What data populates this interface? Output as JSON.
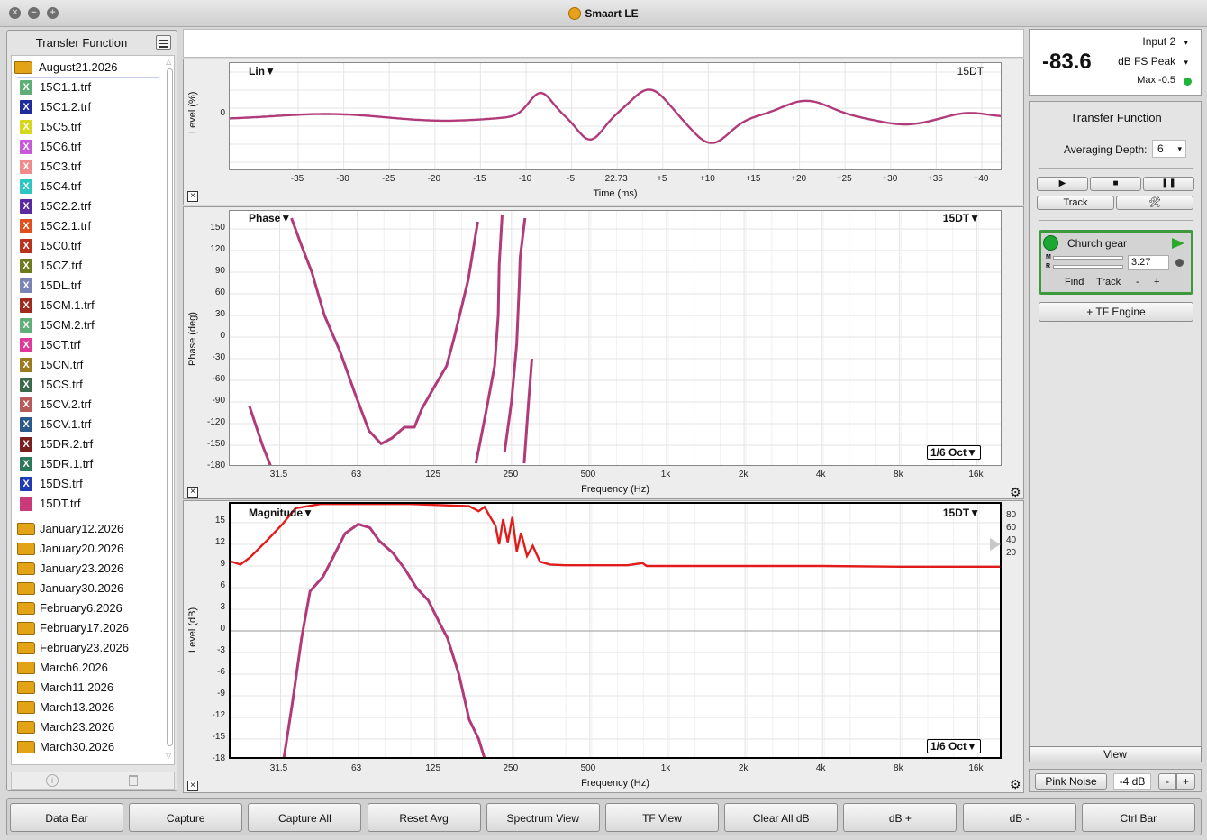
{
  "window": {
    "title": "Smaart LE"
  },
  "left_panel": {
    "title": "Transfer Function",
    "open_folder": "August21.2026",
    "files": [
      {
        "name": "15C1.1.trf",
        "color": "#5fae78"
      },
      {
        "name": "15C1.2.trf",
        "color": "#1e2c9c"
      },
      {
        "name": "15C5.trf",
        "color": "#d6d61c"
      },
      {
        "name": "15C6.trf",
        "color": "#c85ad8"
      },
      {
        "name": "15C3.trf",
        "color": "#f08a8a"
      },
      {
        "name": "15C4.trf",
        "color": "#2dc6c0"
      },
      {
        "name": "15C2.2.trf",
        "color": "#5b2aa0"
      },
      {
        "name": "15C2.1.trf",
        "color": "#e0501e"
      },
      {
        "name": "15C0.trf",
        "color": "#b8321e"
      },
      {
        "name": "15CZ.trf",
        "color": "#6e7a1e"
      },
      {
        "name": "15DL.trf",
        "color": "#7a84b4"
      },
      {
        "name": "15CM.1.trf",
        "color": "#a02a1e"
      },
      {
        "name": "15CM.2.trf",
        "color": "#5fae78"
      },
      {
        "name": "15CT.trf",
        "color": "#e0389a"
      },
      {
        "name": "15CN.trf",
        "color": "#9c7a1e"
      },
      {
        "name": "15CS.trf",
        "color": "#3a6a4a"
      },
      {
        "name": "15CV.2.trf",
        "color": "#b85a5a"
      },
      {
        "name": "15CV.1.trf",
        "color": "#2a5a8c"
      },
      {
        "name": "15DR.2.trf",
        "color": "#7a1e1e"
      },
      {
        "name": "15DR.1.trf",
        "color": "#2a7a5a"
      },
      {
        "name": "15DS.trf",
        "color": "#1e3ab4"
      },
      {
        "name": "15DT.trf",
        "color": "#c83a7a"
      }
    ],
    "folders": [
      "January12.2026",
      "January20.2026",
      "January23.2026",
      "January30.2026",
      "February6.2026",
      "February17.2026",
      "February23.2026",
      "March6.2026",
      "March11.2026",
      "March13.2026",
      "March23.2026",
      "March30.2026"
    ]
  },
  "impulse": {
    "label": "Lin",
    "trace": "15DT",
    "ylabel": "Level (%)",
    "xlabel": "Time (ms)",
    "yticks": [
      "0"
    ],
    "xticks": [
      "-35",
      "-30",
      "-25",
      "-20",
      "-15",
      "-10",
      "-5",
      "22.73",
      "+5",
      "+10",
      "+15",
      "+20",
      "+25",
      "+30",
      "+35",
      "+40"
    ]
  },
  "phase": {
    "label": "Phase",
    "trace": "15DT",
    "ylabel": "Phase (deg)",
    "xlabel": "Frequency (Hz)",
    "smoothing": "1/6 Oct",
    "yticks": [
      "150",
      "120",
      "90",
      "60",
      "30",
      "0",
      "-30",
      "-60",
      "-90",
      "-120",
      "-150",
      "-180"
    ],
    "xticks": [
      "31.5",
      "63",
      "125",
      "250",
      "500",
      "1k",
      "2k",
      "4k",
      "8k",
      "16k"
    ]
  },
  "magnitude": {
    "label": "Magnitude",
    "trace": "15DT",
    "ylabel": "Level (dB)",
    "xlabel": "Frequency (Hz)",
    "smoothing": "1/6 Oct",
    "yticks": [
      "15",
      "12",
      "9",
      "6",
      "3",
      "0",
      "-3",
      "-6",
      "-9",
      "-12",
      "-15",
      "-18"
    ],
    "coherence_ticks": [
      "80",
      "60",
      "40",
      "20"
    ],
    "xticks": [
      "31.5",
      "63",
      "125",
      "250",
      "500",
      "1k",
      "2k",
      "4k",
      "8k",
      "16k"
    ]
  },
  "meter": {
    "input": "Input 2",
    "value": "-83.6",
    "mode": "dB FS Peak",
    "max": "Max -0.5"
  },
  "tf": {
    "title": "Transfer Function",
    "averaging_label": "Averaging Depth:",
    "averaging_value": "6",
    "track_label": "Track",
    "engine": {
      "name": "Church gear",
      "delay": "3.27",
      "find": "Find",
      "track": "Track",
      "minus": "-",
      "plus": "+",
      "m": "M",
      "r": "R"
    },
    "add_engine": "+ TF Engine"
  },
  "view_label": "View",
  "pink": {
    "label": "Pink Noise",
    "level": "-4 dB",
    "minus": "-",
    "plus": "+"
  },
  "bottom_buttons": [
    "Data Bar",
    "Capture",
    "Capture All",
    "Reset Avg",
    "Spectrum View",
    "TF View",
    "Clear All dB",
    "dB +",
    "dB -",
    "Ctrl Bar"
  ]
}
